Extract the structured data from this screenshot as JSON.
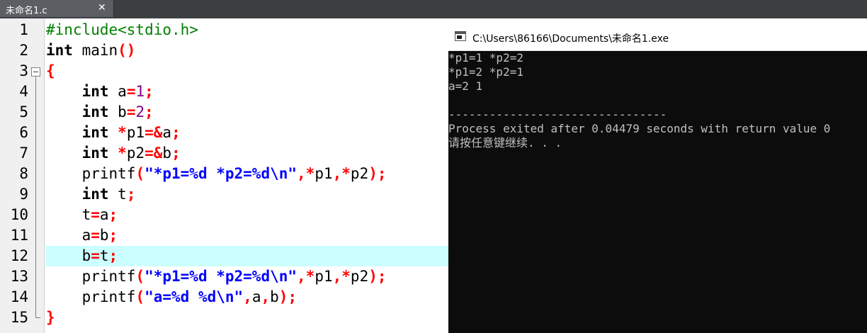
{
  "tab": {
    "label": "未命名1.c",
    "close_symbol": "✕"
  },
  "line_numbers": [
    "1",
    "2",
    "3",
    "4",
    "5",
    "6",
    "7",
    "8",
    "9",
    "10",
    "11",
    "12",
    "13",
    "14",
    "15"
  ],
  "code": {
    "l1": {
      "pp": "#include<stdio.h>"
    },
    "l2": {
      "kw": "int",
      "t1": " main",
      "p1": "()"
    },
    "l3": {
      "op": "{"
    },
    "l4": {
      "indent": "    ",
      "kw": "int",
      "t1": " a",
      "op1": "=",
      "n": "1",
      "op2": ";"
    },
    "l5": {
      "indent": "    ",
      "kw": "int",
      "t1": " b",
      "op1": "=",
      "n": "2",
      "op2": ";"
    },
    "l6": {
      "indent": "    ",
      "kw": "int",
      "sp": " ",
      "op1": "*",
      "t1": "p1",
      "op2": "=&",
      "t2": "a",
      "op3": ";"
    },
    "l7": {
      "indent": "    ",
      "kw": "int",
      "sp": " ",
      "op1": "*",
      "t1": "p2",
      "op2": "=&",
      "t2": "b",
      "op3": ";"
    },
    "l8": {
      "indent": "    ",
      "t1": "printf",
      "op1": "(",
      "str": "\"*p1=%d *p2=%d\\n\"",
      "op2": ",*",
      "t2": "p1",
      "op3": ",*",
      "t3": "p2",
      "op4": ");"
    },
    "l9": {
      "indent": "    ",
      "kw": "int",
      "t1": " t",
      "op1": ";"
    },
    "l10": {
      "indent": "    ",
      "t1": "t",
      "op1": "=",
      "t2": "a",
      "op2": ";"
    },
    "l11": {
      "indent": "    ",
      "t1": "a",
      "op1": "=",
      "t2": "b",
      "op2": ";"
    },
    "l12": {
      "indent": "    ",
      "t1": "b",
      "op1": "=",
      "t2": "t",
      "op2": ";"
    },
    "l13": {
      "indent": "    ",
      "t1": "printf",
      "op1": "(",
      "str": "\"*p1=%d *p2=%d\\n\"",
      "op2": ",*",
      "t2": "p1",
      "op3": ",*",
      "t3": "p2",
      "op4": ");"
    },
    "l14": {
      "indent": "    ",
      "t1": "printf",
      "op1": "(",
      "str": "\"a=%d %d\\n\"",
      "op2": ",",
      "t2": "a",
      "op3": ",",
      "t3": "b",
      "op4": ");"
    },
    "l15": {
      "op": "}"
    }
  },
  "console": {
    "title": "C:\\Users\\86166\\Documents\\未命名1.exe",
    "output": [
      "*p1=1 *p2=2",
      "*p1=2 *p2=1",
      "a=2 1",
      "",
      "--------------------------------",
      "Process exited after 0.04479 seconds with return value 0",
      "请按任意键继续. . ."
    ]
  },
  "colors": {
    "keyword": "#000000",
    "preprocessor": "#008000",
    "operator": "#ff0000",
    "number": "#800080",
    "string": "#0000ff",
    "current_line": "#ccffff",
    "console_bg": "#0c0c0c",
    "console_text": "#c0c0c0"
  }
}
